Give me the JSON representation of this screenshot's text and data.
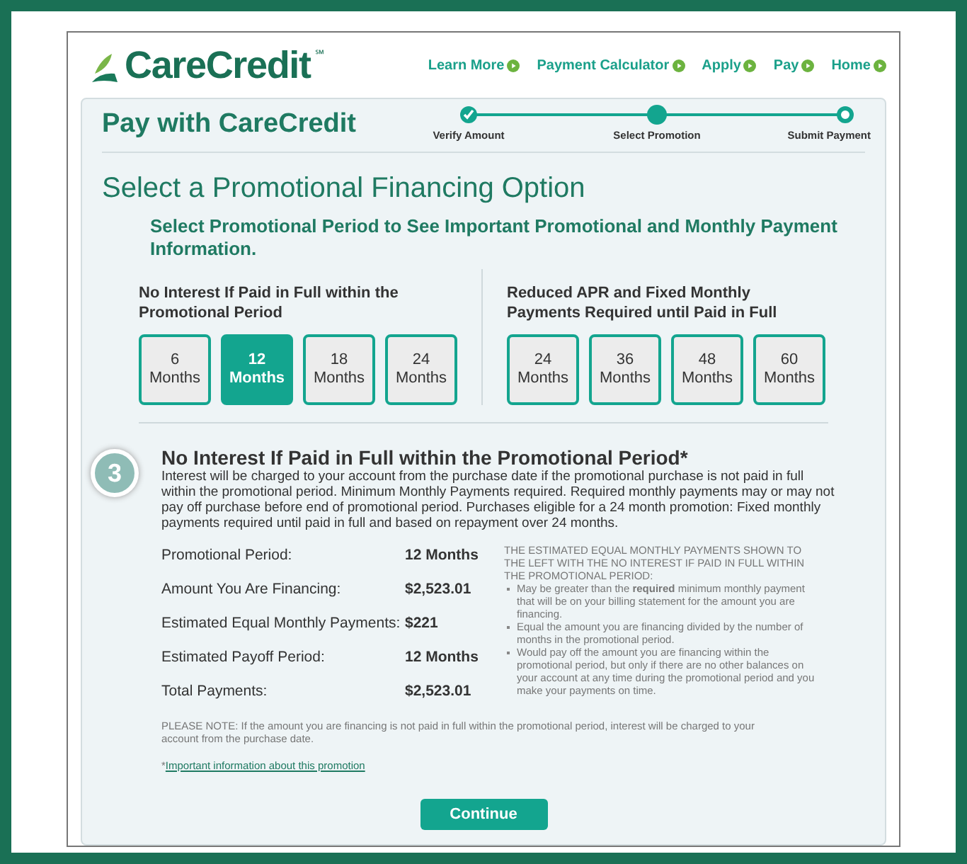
{
  "header": {
    "logo": "CareCredit",
    "logo_mark": "℠",
    "nav": [
      {
        "label": "Learn More"
      },
      {
        "label": "Payment Calculator"
      },
      {
        "label": "Apply"
      },
      {
        "label": "Pay"
      },
      {
        "label": "Home"
      }
    ]
  },
  "panel": {
    "title": "Pay with CareCredit",
    "steps": [
      {
        "label": "Verify Amount",
        "completed": true,
        "selected": false
      },
      {
        "label": "Select Promotion",
        "completed": false,
        "selected": true
      },
      {
        "label": "Submit Payment",
        "completed": false,
        "selected": false
      }
    ],
    "heading": "Select a Promotional Financing Option",
    "subheading": "Select Promotional Period to See Important Promotional and Monthly Payment Information.",
    "groups": [
      {
        "title": "No Interest If Paid in Full within the Promotional Period",
        "options": [
          {
            "number": "6",
            "unit": "Months",
            "selected": false
          },
          {
            "number": "12",
            "unit": "Months",
            "selected": true
          },
          {
            "number": "18",
            "unit": "Months",
            "selected": false
          },
          {
            "number": "24",
            "unit": "Months",
            "selected": false
          }
        ]
      },
      {
        "title": "Reduced APR and Fixed Monthly Payments Required until Paid in Full",
        "options": [
          {
            "number": "24",
            "unit": "Months",
            "selected": false
          },
          {
            "number": "36",
            "unit": "Months",
            "selected": false
          },
          {
            "number": "48",
            "unit": "Months",
            "selected": false
          },
          {
            "number": "60",
            "unit": "Months",
            "selected": false
          }
        ]
      }
    ],
    "step_badge": "3",
    "detail_title": "No Interest If Paid in Full within the Promotional Period*",
    "detail_text": "Interest will be charged to your account from the purchase date if the promotional purchase is not paid in full within the promotional period. Minimum Monthly Payments required. Required monthly payments may or may not pay off purchase before end of promotional period. Purchases eligible for a 24 month promotion:  Fixed monthly payments required until paid in full and based on repayment over 24 months.",
    "summary": [
      {
        "label": "Promotional Period:",
        "value": "12 Months"
      },
      {
        "label": "Amount You Are Financing:",
        "value": "$2,523.01"
      },
      {
        "label": "Estimated Equal Monthly Payments:",
        "value": "$221"
      },
      {
        "label": "Estimated Payoff Period:",
        "value": "12 Months"
      },
      {
        "label": "Total Payments:",
        "value": "$2,523.01"
      }
    ],
    "side_note": {
      "intro": "THE ESTIMATED EQUAL MONTHLY PAYMENTS SHOWN TO THE LEFT WITH THE NO INTEREST IF PAID IN FULL WITHIN THE PROMOTIONAL PERIOD:",
      "bullets": [
        "May be greater than the **required** minimum monthly payment that will be on your billing statement for the amount you are financing.",
        "Equal the amount you are financing divided by the number of months in the promotional period.",
        "Would pay off the amount you are financing within the promotional period, but only if there are no other balances on your account at any time during the promotional period and you make your payments on time."
      ]
    },
    "please_note": "PLEASE NOTE:  If the amount you are financing is not paid in full within the promotional period, interest will be charged to your account from the purchase date.",
    "footnote_mark": "*",
    "footnote_link": "Important information about this promotion",
    "continue_button": "Continue"
  }
}
